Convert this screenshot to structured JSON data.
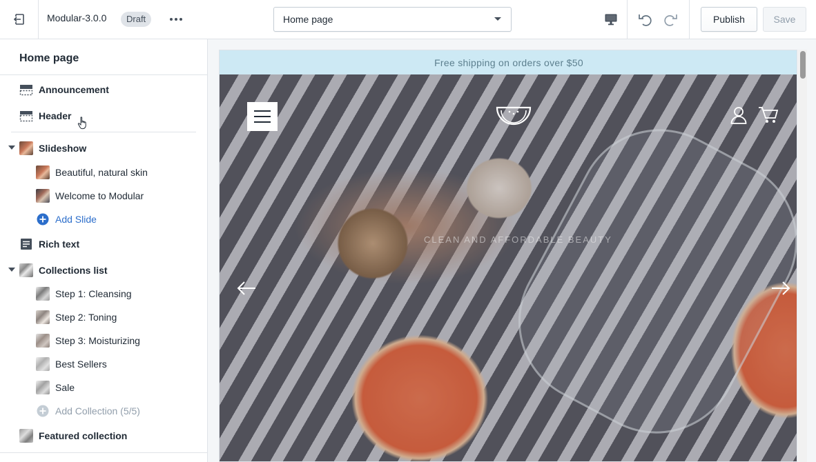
{
  "topbar": {
    "theme_name": "Modular-3.0.0",
    "status_badge": "Draft",
    "page_selector": {
      "selected": "Home page"
    },
    "publish_label": "Publish",
    "save_label": "Save"
  },
  "sidebar": {
    "title": "Home page",
    "sections": [
      {
        "label": "Announcement",
        "icon": "announcement-bar-icon"
      },
      {
        "label": "Header",
        "icon": "header-layout-icon"
      },
      {
        "label": "Slideshow",
        "icon": "slideshow-thumbnail",
        "expanded": true,
        "children": [
          {
            "label": "Beautiful, natural skin"
          },
          {
            "label": "Welcome to Modular"
          }
        ],
        "add_label": "Add Slide"
      },
      {
        "label": "Rich text",
        "icon": "rich-text-icon"
      },
      {
        "label": "Collections list",
        "icon": "collections-thumbnail",
        "expanded": true,
        "children": [
          {
            "label": "Step 1: Cleansing"
          },
          {
            "label": "Step 2: Toning"
          },
          {
            "label": "Step 3: Moisturizing"
          },
          {
            "label": "Best Sellers"
          },
          {
            "label": "Sale"
          }
        ],
        "add_label": "Add Collection (5/5)"
      },
      {
        "label": "Featured collection",
        "icon": "featured-collection-thumbnail"
      }
    ]
  },
  "preview": {
    "announcement": "Free shipping on orders over $50",
    "hero_subheading": "CLEAN AND AFFORDABLE BEAUTY"
  },
  "colors": {
    "announcement_bg": "#cde9f4",
    "link_blue": "#2c6ecb",
    "border": "#dfe3e8"
  }
}
